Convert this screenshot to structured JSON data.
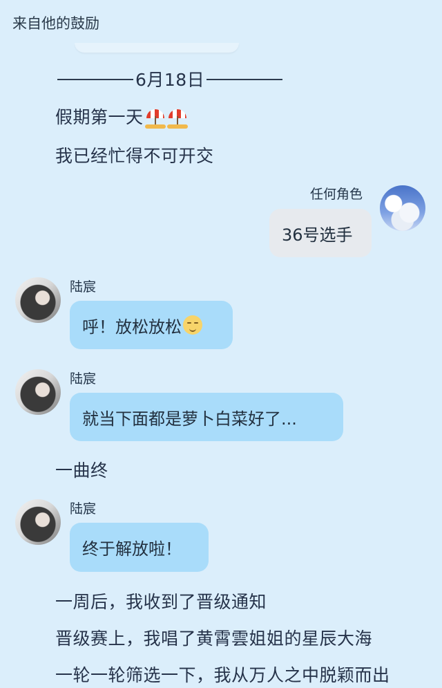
{
  "header": {
    "title": "来自他的鼓励"
  },
  "date_divider": {
    "text": "6月18日"
  },
  "narration": {
    "line1": "假期第一天",
    "line2": "我已经忙得不可开交",
    "line3": "一曲终",
    "line4": "一周后，我收到了晋级通知",
    "line5": "晋级赛上，我唱了黄霄雲姐姐的星辰大海",
    "line6": "一轮一轮筛选一下，我从万人之中脱颖而出"
  },
  "messages": [
    {
      "sender": "任何角色",
      "text": "36号选手",
      "side": "right",
      "avatar_icon": "sky-avatar-icon"
    },
    {
      "sender": "陆宸",
      "text": "呼！放松放松",
      "side": "left",
      "avatar_icon": "girl-avatar-icon"
    },
    {
      "sender": "陆宸",
      "text": "就当下面都是萝卜白菜好了...",
      "side": "left",
      "avatar_icon": "girl-avatar-icon"
    },
    {
      "sender": "陆宸",
      "text": "终于解放啦！",
      "side": "left",
      "avatar_icon": "girl-avatar-icon"
    }
  ],
  "colors": {
    "background": "#dbeefb",
    "bubble_blue": "#a9dcfa",
    "bubble_gray": "#e7eaee"
  }
}
